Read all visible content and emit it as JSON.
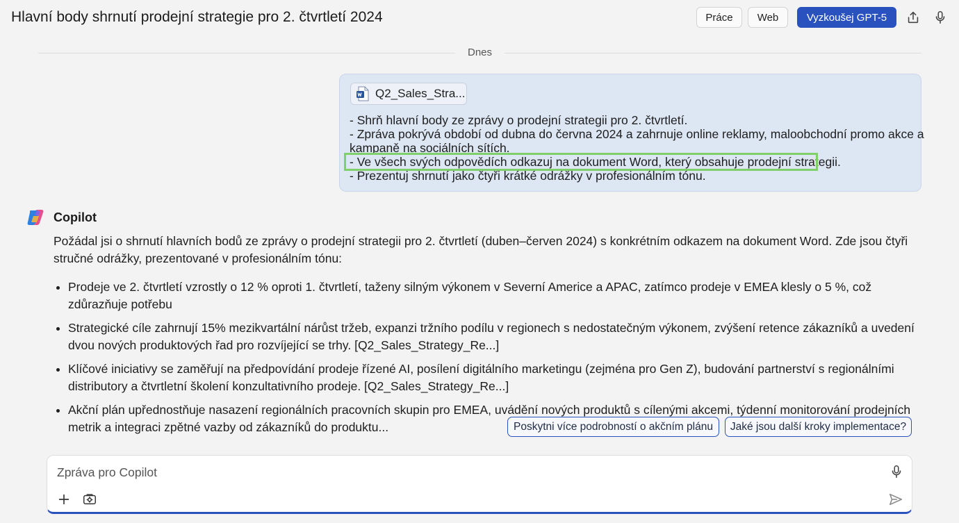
{
  "header": {
    "title": "Hlavní body shrnutí prodejní strategie pro 2. čtvrtletí 2024",
    "buttons": {
      "prace": "Práce",
      "web": "Web",
      "gpt": "Vyzkoušej GPT-5"
    },
    "icons": [
      "share-icon",
      "microphone-icon"
    ]
  },
  "chat": {
    "date_label": "Dnes",
    "user_message": {
      "file_name": "Q2_Sales_Stra...",
      "lines": [
        "- Shrň hlavní body ze zprávy o prodejní strategii pro 2. čtvrtletí.",
        "- Zpráva pokrývá období od dubna do června 2024 a zahrnuje online reklamy, maloobchodní promo akce a",
        "kampaně na sociálních sítích.",
        "- Ve všech svých odpovědích odkazuj na dokument Word, který obsahuje prodejní strategii.",
        "- Prezentuj shrnutí jako čtyři krátké odrážky v profesionálním tónu."
      ]
    },
    "assistant": {
      "name": "Copilot",
      "intro": "Požádal jsi o shrnutí hlavních bodů ze zprávy o prodejní strategii pro 2. čtvrtletí (duben–červen 2024) s konkrétním odkazem na dokument Word. Zde jsou čtyři stručné odrážky, prezentované v profesionálním tónu:",
      "bullets": [
        "Prodeje ve 2. čtvrtletí vzrostly o 12 % oproti 1. čtvrtletí, taženy silným výkonem v Severní Americe a APAC, zatímco prodeje v EMEA klesly o 5 %, což zdůrazňuje potřebu",
        "Strategické cíle zahrnují 15% mezikvartální nárůst tržeb, expanzi tržního podílu v regionech s nedostatečným výkonem, zvýšení retence zákazníků a uvedení dvou nových produktových řad pro rozvíjející se trhy. [Q2_Sales_Strategy_Re...]",
        "Klíčové iniciativy se zaměřují na předpovídání prodeje řízené AI, posílení digitálního marketingu (zejména pro Gen Z), budování partnerství s regionálními distributory a čtvrtletní školení konzultativního prodeje. [Q2_Sales_Strategy_Re...]",
        "Akční plán upřednostňuje nasazení regionálních pracovních skupin pro EMEA, uvádění nových produktů s cílenými akcemi, týdenní monitorování prodejních metrik a integraci zpětné vazby od zákazníků do produktu..."
      ]
    },
    "suggestions": [
      "Poskytni více podrobností o akčním plánu",
      "Jaké jsou další kroky implementace?"
    ]
  },
  "composer": {
    "placeholder": "Zpráva pro Copilot",
    "icons": [
      "microphone-icon",
      "plus-icon",
      "tools-icon",
      "send-icon"
    ]
  },
  "colors": {
    "accent": "#2a52be",
    "bubble": "#dde6f3",
    "highlight": "#7fcf6b",
    "background": "#f3f3f4"
  }
}
